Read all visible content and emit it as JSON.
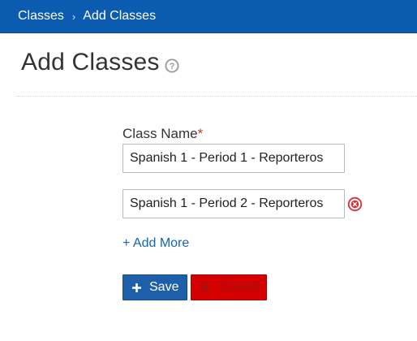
{
  "breadcrumb": {
    "parent": "Classes",
    "separator": "›",
    "current": "Add Classes"
  },
  "page": {
    "title": "Add Classes",
    "help_icon": "question-circle-icon"
  },
  "form": {
    "label": "Class Name",
    "required_mark": "*",
    "inputs": [
      {
        "value": "Spanish 1 - Period 1 - Reporteros"
      },
      {
        "value": "Spanish 1 - Period 2 - Reporteros",
        "remove_icon": "remove-circle-icon"
      }
    ],
    "add_more_label": "+ Add More"
  },
  "actions": {
    "save_label": "Save",
    "save_icon": "plus-icon",
    "cancel_label": "Cancel",
    "cancel_icon": "x-icon"
  },
  "colors": {
    "topbar": "#0b5cb0",
    "save_button": "#1d5fa8",
    "cancel_button": "#d40000",
    "remove_icon": "#d9303a",
    "link": "#1565b2"
  }
}
